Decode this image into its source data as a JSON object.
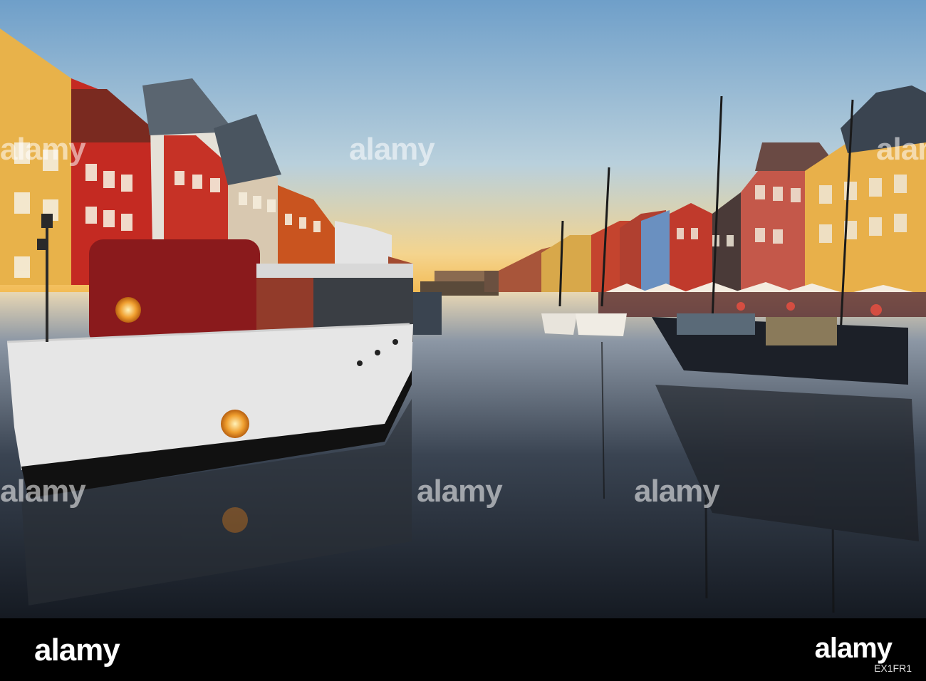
{
  "watermark": {
    "text": "alamy",
    "glyph": "a"
  },
  "footer": {
    "brand": "alamy",
    "image_id": "EX1FR1"
  },
  "colors": {
    "sky_top": "#7fa6c8",
    "sky_horizon": "#f2c05a",
    "water": "#2a3542",
    "boat_red": "#8a1a1c",
    "hull_white": "#e8e8e8",
    "window_glow": "#f0a030"
  }
}
